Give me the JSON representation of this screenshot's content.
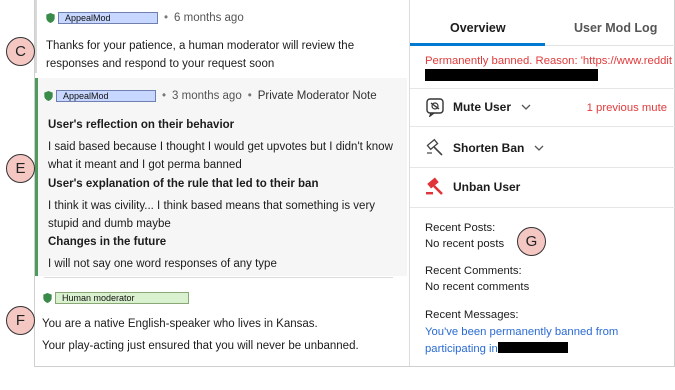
{
  "markers": {
    "c": "C",
    "e": "E",
    "f": "F",
    "g": "G"
  },
  "messages": {
    "c": {
      "author": "AppealMod",
      "time": "6 months ago",
      "body": "Thanks for your patience, a human moderator will review the responses and respond to your request soon"
    },
    "e": {
      "author": "AppealMod",
      "time": "3 months ago",
      "note": "Private Moderator Note",
      "sections": [
        {
          "heading": "User's reflection on their behavior",
          "text": "I said based because I thought I would get upvotes but I didn't know what it meant and I got perma banned"
        },
        {
          "heading": "User's explanation of the rule that led to their ban",
          "text": "I think it was civility... I think based means that something is very stupid and dumb maybe"
        },
        {
          "heading": "Changes in the future",
          "text": "I will not say one word responses of any type"
        }
      ]
    },
    "f": {
      "author": "Human moderator",
      "line1": "You are a native English-speaker who lives in Kansas.",
      "line2": "Your play-acting just ensured that you will never be unbanned."
    }
  },
  "tabs": {
    "overview": "Overview",
    "modlog": "User Mod Log"
  },
  "ban": {
    "reason": "Permanently banned. Reason: 'https://www.reddit.com"
  },
  "actions": {
    "mute": "Mute User",
    "prev_mute": "1 previous mute",
    "shorten": "Shorten Ban",
    "unban": "Unban User"
  },
  "info": {
    "posts_label": "Recent Posts:",
    "posts_value": "No recent posts",
    "comments_label": "Recent Comments:",
    "comments_value": "No recent comments",
    "messages_label": "Recent Messages:",
    "messages_value": "You've been permanently banned from participating in"
  },
  "colors": {
    "accent": "#0079d3",
    "ban_red": "#e03b3b",
    "note_green": "#4f9a5d",
    "link_blue": "#2a6bd3"
  }
}
